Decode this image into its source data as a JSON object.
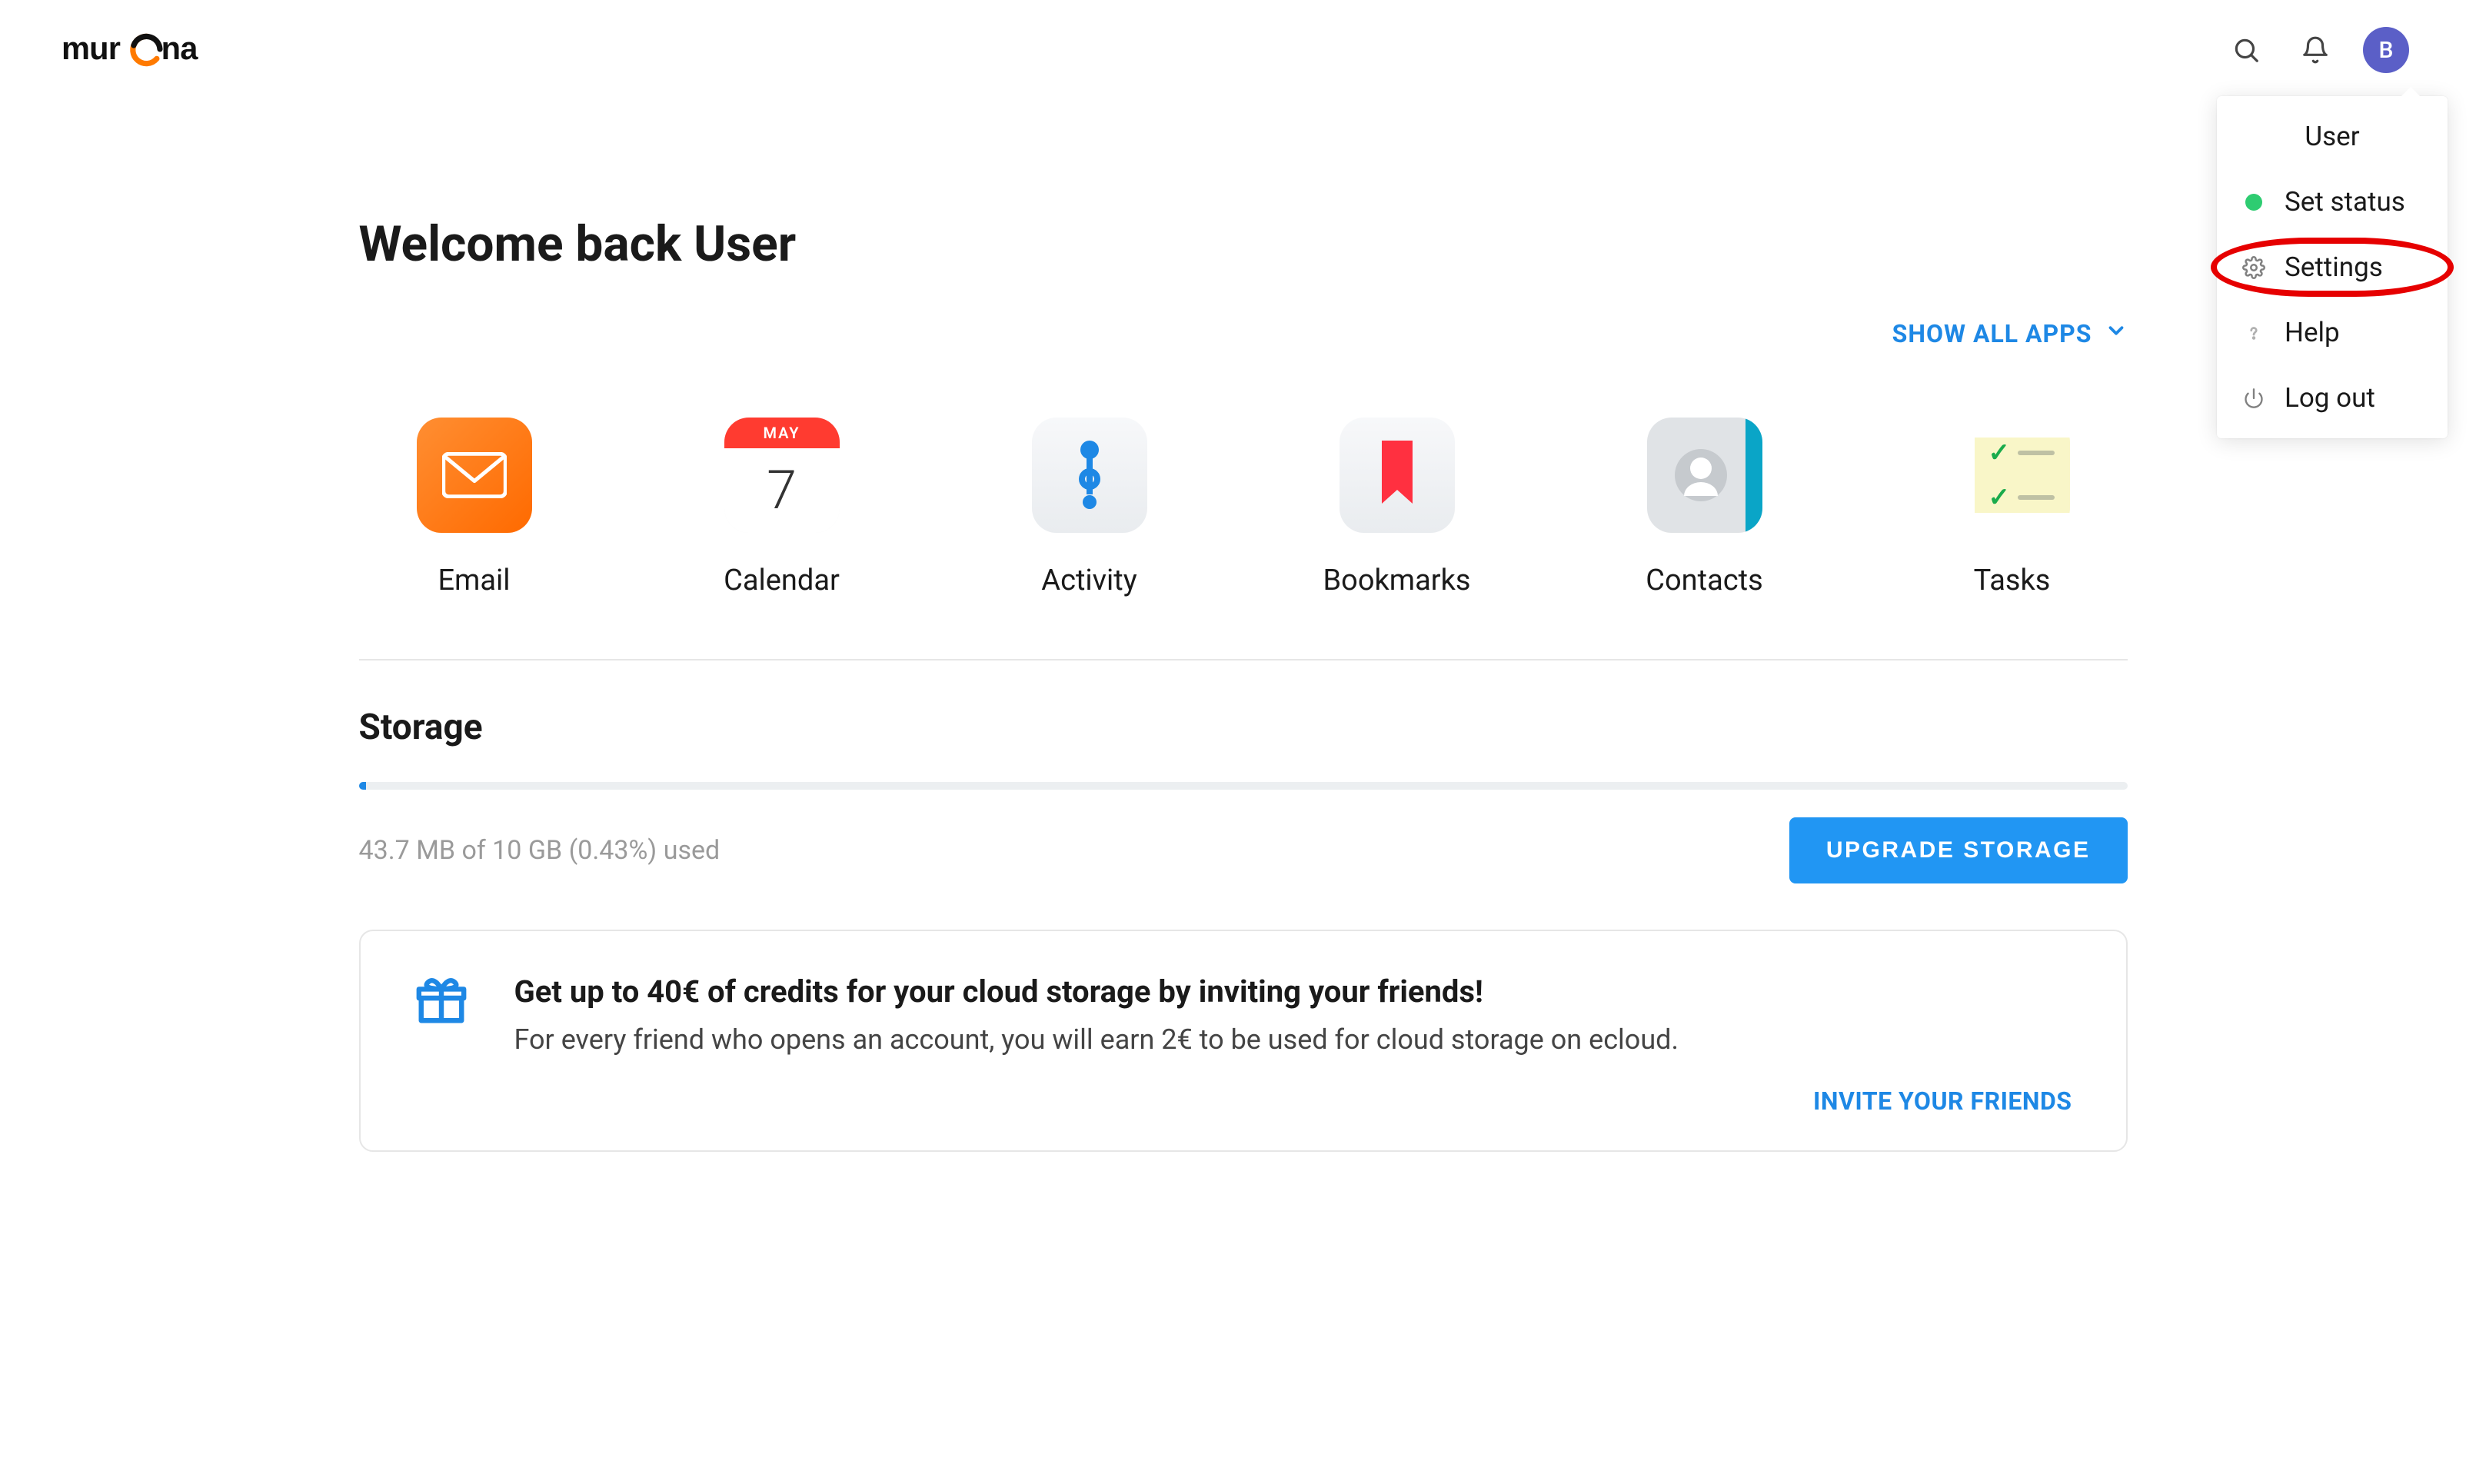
{
  "brand": {
    "name": "murena"
  },
  "header": {
    "avatar_initial": "B"
  },
  "dropdown": {
    "user_label": "User",
    "set_status_label": "Set status",
    "settings_label": "Settings",
    "help_label": "Help",
    "logout_label": "Log out"
  },
  "welcome_heading": "Welcome back User",
  "show_all_label": "SHOW ALL APPS",
  "apps": {
    "email": "Email",
    "calendar": "Calendar",
    "calendar_month": "MAY",
    "calendar_day": "7",
    "activity": "Activity",
    "bookmarks": "Bookmarks",
    "contacts": "Contacts",
    "tasks": "Tasks"
  },
  "storage": {
    "title": "Storage",
    "usage_text": "43.7 MB of 10 GB (0.43%) used",
    "percent": 0.43,
    "upgrade_label": "UPGRADE STORAGE"
  },
  "invite": {
    "title": "Get up to 40€ of credits for your cloud storage by inviting your friends!",
    "subtitle": "For every friend who opens an account, you will earn 2€ to be used for cloud storage on ecloud.",
    "cta": "INVITE YOUR FRIENDS"
  }
}
